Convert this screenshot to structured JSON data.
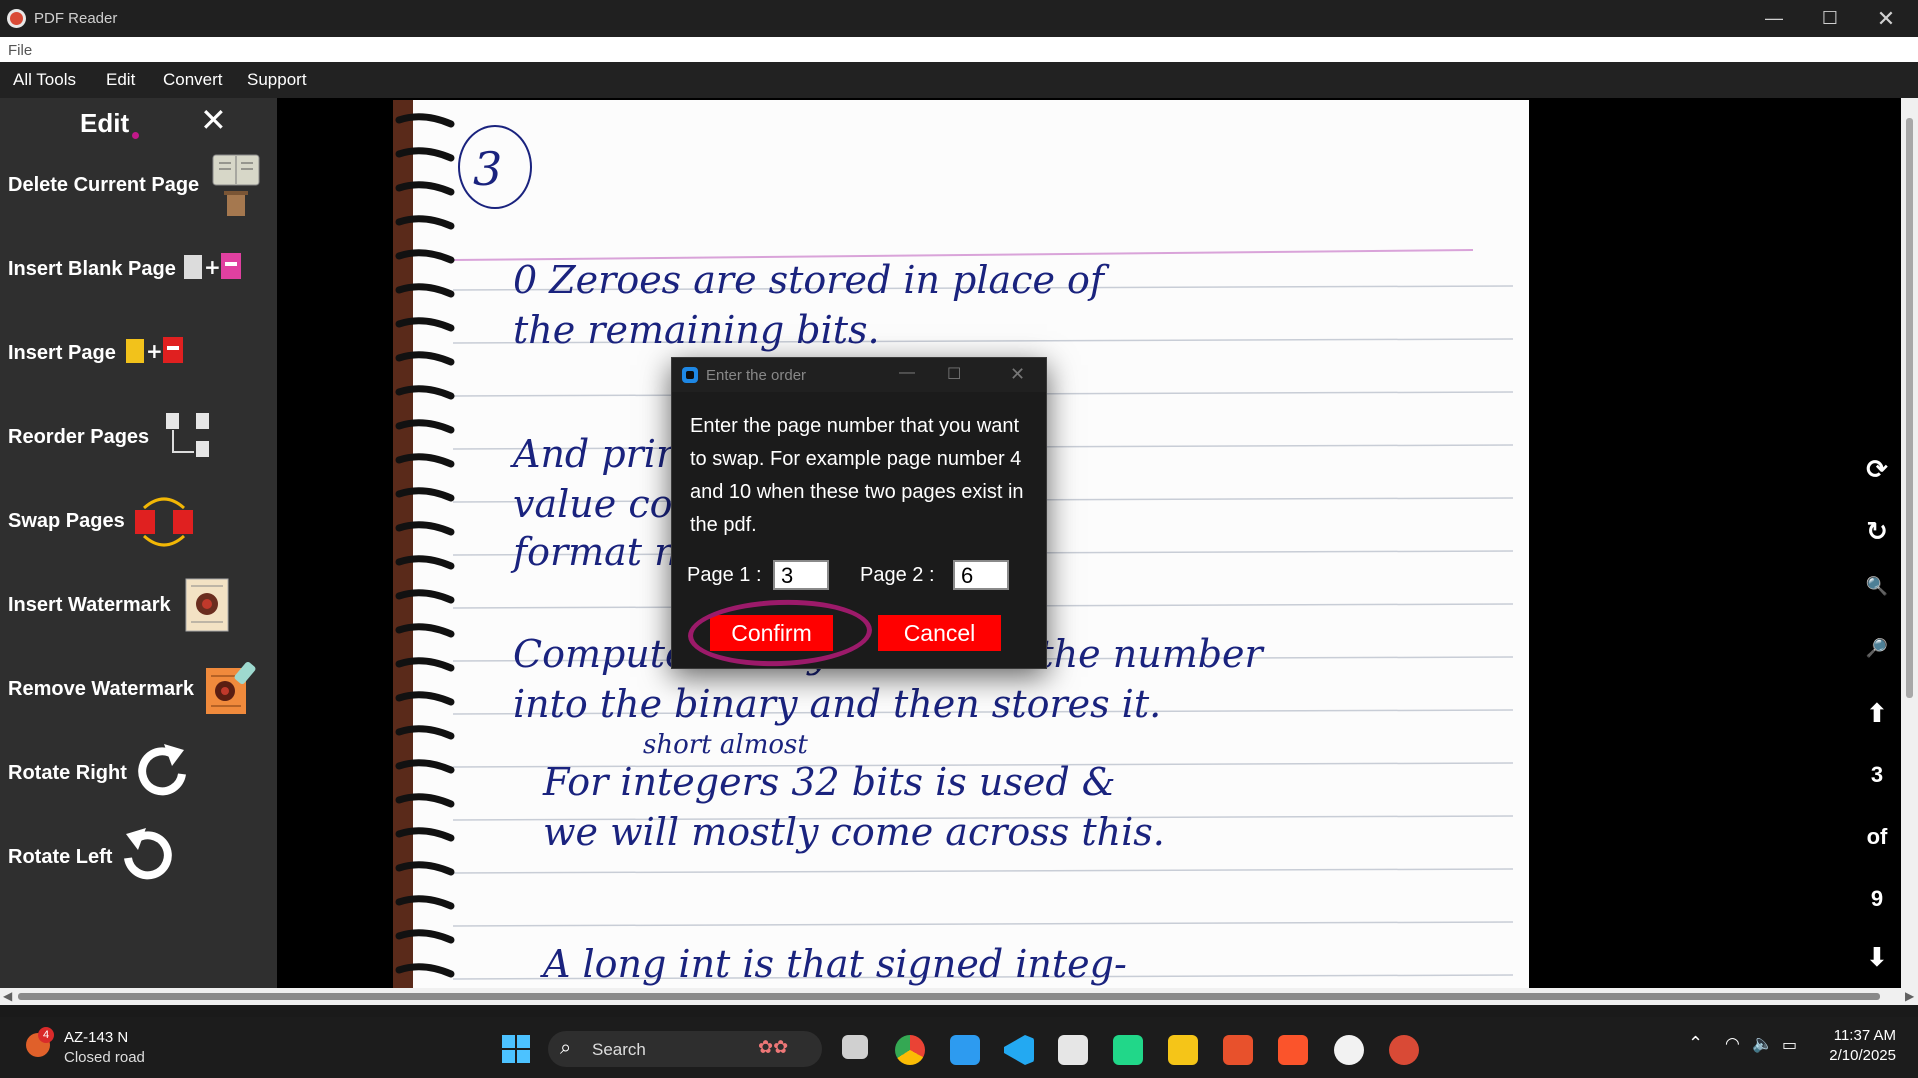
{
  "window": {
    "title": "PDF Reader"
  },
  "menubar": {
    "file": "File"
  },
  "toolbar": {
    "all_tools": "All Tools",
    "edit": "Edit",
    "convert": "Convert",
    "support": "Support"
  },
  "edit_panel": {
    "title": "Edit",
    "close": "✕",
    "items": [
      {
        "label": "Delete Current Page",
        "icon": "book-trash-icon"
      },
      {
        "label": "Insert Blank Page",
        "icon": "blank-page-plus-icon"
      },
      {
        "label": "Insert Page",
        "icon": "page-plus-icon"
      },
      {
        "label": "Reorder Pages",
        "icon": "reorder-icon"
      },
      {
        "label": "Swap Pages",
        "icon": "swap-icon"
      },
      {
        "label": "Insert Watermark",
        "icon": "watermark-icon"
      },
      {
        "label": "Remove Watermark",
        "icon": "remove-watermark-icon"
      },
      {
        "label": "Rotate Right",
        "icon": "rotate-right-icon"
      },
      {
        "label": "Rotate Left",
        "icon": "rotate-left-icon"
      }
    ]
  },
  "document": {
    "lines": [
      "3",
      "0 Zeroes are stored in place of",
      "the remaining bits.",
      "And printing the",
      "value converts binary",
      "format number. ( decimal)",
      "Computer always converts the number",
      "into the binary and then stores it.",
      "short almost",
      "For integers 32 bits is used &",
      "we will mostly come across this.",
      "A long int is that signed integ-"
    ]
  },
  "page_nav": {
    "current": "3",
    "of": "of",
    "total": "9"
  },
  "dialog": {
    "title": "Enter the order",
    "message": "Enter the page number that you want to swap. For example page number 4 and 10 when these two pages exist in the pdf.",
    "page1_label": "Page 1 :",
    "page1_value": "3",
    "page2_label": "Page 2 :",
    "page2_value": "6",
    "confirm": "Confirm",
    "cancel": "Cancel"
  },
  "taskbar": {
    "weather_badge": "4",
    "weather_title": "AZ-143 N",
    "weather_sub": "Closed road",
    "search": "Search",
    "time": "11:37 AM",
    "date": "2/10/2025"
  },
  "colors": {
    "accent_red": "#ff0000",
    "annotation_circle": "#9c1a6a",
    "ink": "#1a237e",
    "panel": "#2f2f2f"
  }
}
